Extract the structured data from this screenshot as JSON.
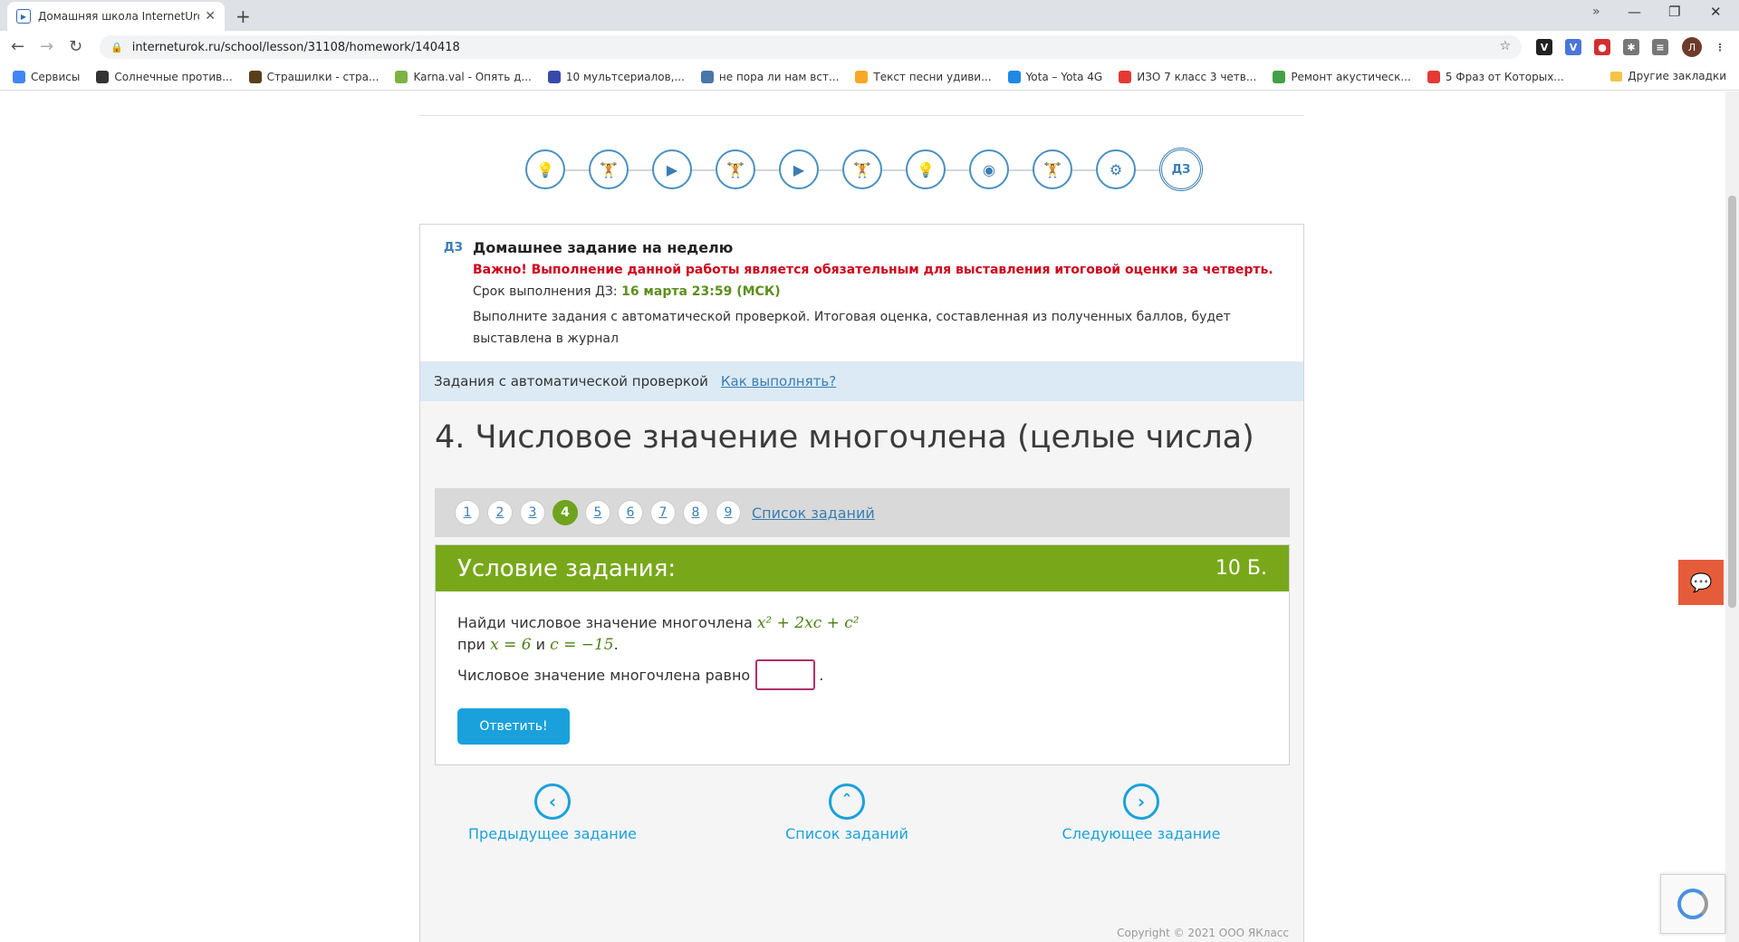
{
  "browser": {
    "tab_title": "Домашняя школа InternetUrok.r",
    "url": "interneturok.ru/school/lesson/31108/homework/140418",
    "bookmarks": [
      {
        "label": "Сервисы",
        "icon": "apps-grid-icon",
        "color": "#4285f4"
      },
      {
        "label": "Солнечные против...",
        "icon": "hourglass-icon",
        "color": "#333333"
      },
      {
        "label": "Страшилки - стра...",
        "icon": "book-icon",
        "color": "#5a3e1b"
      },
      {
        "label": "Karna.val - Опять д...",
        "icon": "music-icon",
        "color": "#7cb342"
      },
      {
        "label": "10 мультсериалов,...",
        "icon": "w-logo-icon",
        "color": "#3949ab"
      },
      {
        "label": "не пора ли нам вст...",
        "icon": "vk-icon",
        "color": "#4a76a8"
      },
      {
        "label": "Текст песни удиви...",
        "icon": "note-icon",
        "color": "#f9a825"
      },
      {
        "label": "Yota – Yota 4G",
        "icon": "yota-icon",
        "color": "#1e88e5"
      },
      {
        "label": "ИЗО 7 класс 3 четв...",
        "icon": "youtube-icon",
        "color": "#e53935"
      },
      {
        "label": "Ремонт акустическ...",
        "icon": "dots-icon",
        "color": "#43a047"
      },
      {
        "label": "5 Фраз от Которых...",
        "icon": "youtube-icon",
        "color": "#e53935"
      }
    ],
    "other_bookmarks": "Другие закладки",
    "profile_initial": "Л"
  },
  "steps": [
    "bulb",
    "dumbbell",
    "play",
    "dumbbell",
    "play",
    "dumbbell",
    "bulb",
    "webcam",
    "dumbbell",
    "dumbbell-multi",
    "ДЗ"
  ],
  "homework": {
    "tag": "ДЗ",
    "title": "Домашнее задание на неделю",
    "warning": "Важно! Выполнение данной работы является обязательным для выставления итоговой оценки за четверть.",
    "deadline_label": "Срок выполнения ДЗ: ",
    "deadline_value": "16 марта 23:59 (МСК)",
    "description": "Выполните задания с автоматической проверкой. Итоговая оценка, составленная из полученных баллов, будет выставлена в журнал"
  },
  "auto_check": {
    "label": "Задания с автоматической проверкой",
    "how_link": "Как выполнять?"
  },
  "task": {
    "title": "4. Числовое значение многочлена (целые числа)",
    "pages": [
      "1",
      "2",
      "3",
      "4",
      "5",
      "6",
      "7",
      "8",
      "9"
    ],
    "active_page": 4,
    "list_link": "Список заданий",
    "condition_label": "Условие задания:",
    "points": "10 Б.",
    "q_text": "Найди числовое значение многочлена ",
    "q_poly": "x² + 2xc + c²",
    "q_at": "при ",
    "q_x": "x = 6",
    "q_and": " и ",
    "q_c": "c = −15",
    "q_dot": ".",
    "answer_label": "Числовое значение многочлена равно",
    "answer_value": "",
    "answer_suffix": ".",
    "submit": "Ответить!"
  },
  "nav": {
    "prev": "Предыдущее задание",
    "list": "Список заданий",
    "next": "Следующее задание"
  },
  "copyright": "Copyright © 2021 ООО ЯКласс"
}
